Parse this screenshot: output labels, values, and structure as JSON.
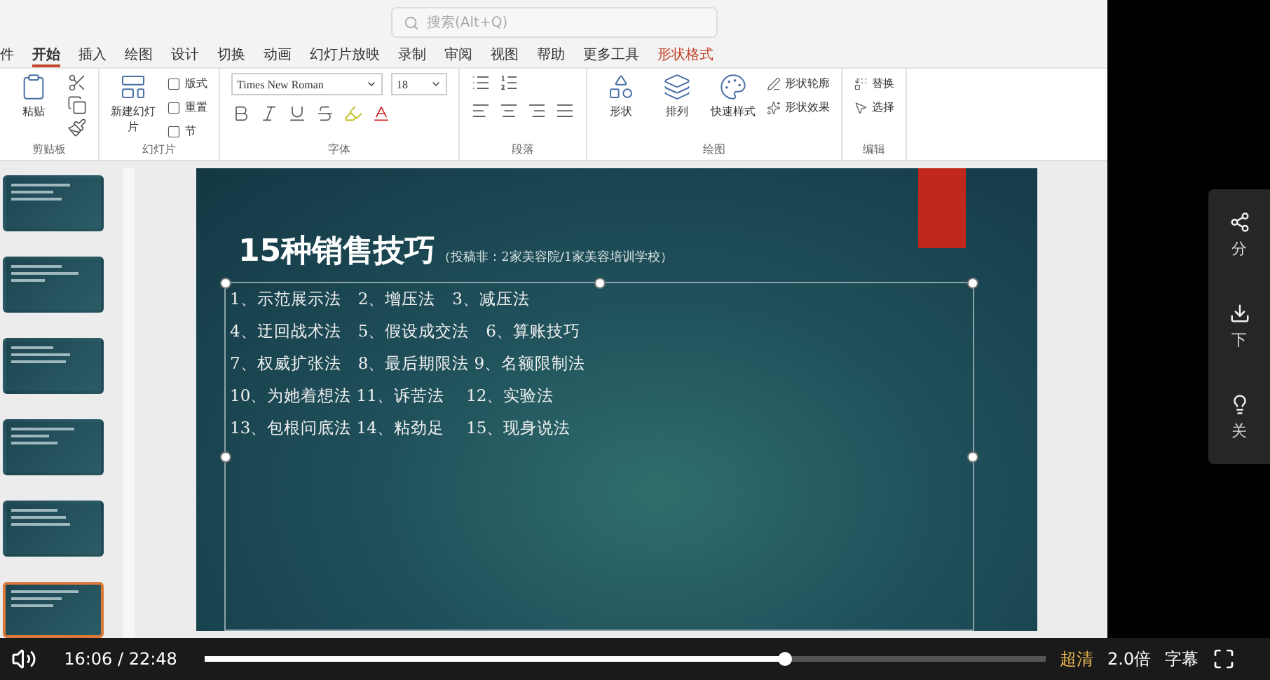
{
  "title_bar": {
    "search": {
      "placeholder": "搜索(Alt+Q)"
    }
  },
  "ribbon_tabs": [
    {
      "label": "件",
      "selected": false,
      "contextual": false
    },
    {
      "label": "开始",
      "selected": true,
      "contextual": false
    },
    {
      "label": "插入",
      "selected": false,
      "contextual": false
    },
    {
      "label": "绘图",
      "selected": false,
      "contextual": false
    },
    {
      "label": "设计",
      "selected": false,
      "contextual": false
    },
    {
      "label": "切换",
      "selected": false,
      "contextual": false
    },
    {
      "label": "动画",
      "selected": false,
      "contextual": false
    },
    {
      "label": "幻灯片放映",
      "selected": false,
      "contextual": false
    },
    {
      "label": "录制",
      "selected": false,
      "contextual": false
    },
    {
      "label": "审阅",
      "selected": false,
      "contextual": false
    },
    {
      "label": "视图",
      "selected": false,
      "contextual": false
    },
    {
      "label": "帮助",
      "selected": false,
      "contextual": false
    },
    {
      "label": "更多工具",
      "selected": false,
      "contextual": false
    },
    {
      "label": "形状格式",
      "selected": false,
      "contextual": true
    }
  ],
  "ribbon": {
    "groups": [
      {
        "label": "剪贴板",
        "kind": "clipboard",
        "large": [
          "粘贴"
        ]
      },
      {
        "label": "幻灯片",
        "kind": "slides",
        "large": [
          "新建幻灯片"
        ],
        "small": [
          "版式",
          "重置",
          "节"
        ]
      },
      {
        "label": "字体",
        "kind": "font",
        "font": "Times New Roman",
        "size": "18"
      },
      {
        "label": "段落",
        "kind": "paragraph"
      },
      {
        "label": "绘图",
        "kind": "drawing",
        "large": [
          "形状",
          "排列",
          "快速样式"
        ],
        "small": [
          "形状轮廓",
          "形状效果"
        ]
      },
      {
        "label": "编辑",
        "kind": "editing",
        "small": [
          "替换",
          "选择"
        ]
      }
    ]
  },
  "thumbnails": [
    {
      "selected": false
    },
    {
      "selected": false
    },
    {
      "selected": false
    },
    {
      "selected": false
    },
    {
      "selected": false
    },
    {
      "selected": true
    }
  ],
  "slide": {
    "title": "15种销售技巧",
    "subtitle": "（投稿非：2家美容院/1家美容培训学校）",
    "lines": [
      "1、示范展示法　2、增压法　3、减压法",
      "4、迂回战术法　5、假设成交法　6、算账技巧",
      "7、权威扩张法　8、最后期限法 9、名额限制法",
      "10、为她着想法 11、诉苦法　 12、实验法",
      "13、包根问底法 14、粘劲足　 15、现身说法"
    ]
  },
  "side_panel": {
    "items": [
      {
        "kind": "share",
        "label": "分"
      },
      {
        "kind": "download",
        "label": "下"
      },
      {
        "kind": "light",
        "label": "关"
      }
    ]
  },
  "player": {
    "time": "16:06 / 22:48",
    "progress": {
      "level": 0.69
    },
    "quality": "超清",
    "speed": "2.0倍",
    "subtitles": "字幕"
  }
}
